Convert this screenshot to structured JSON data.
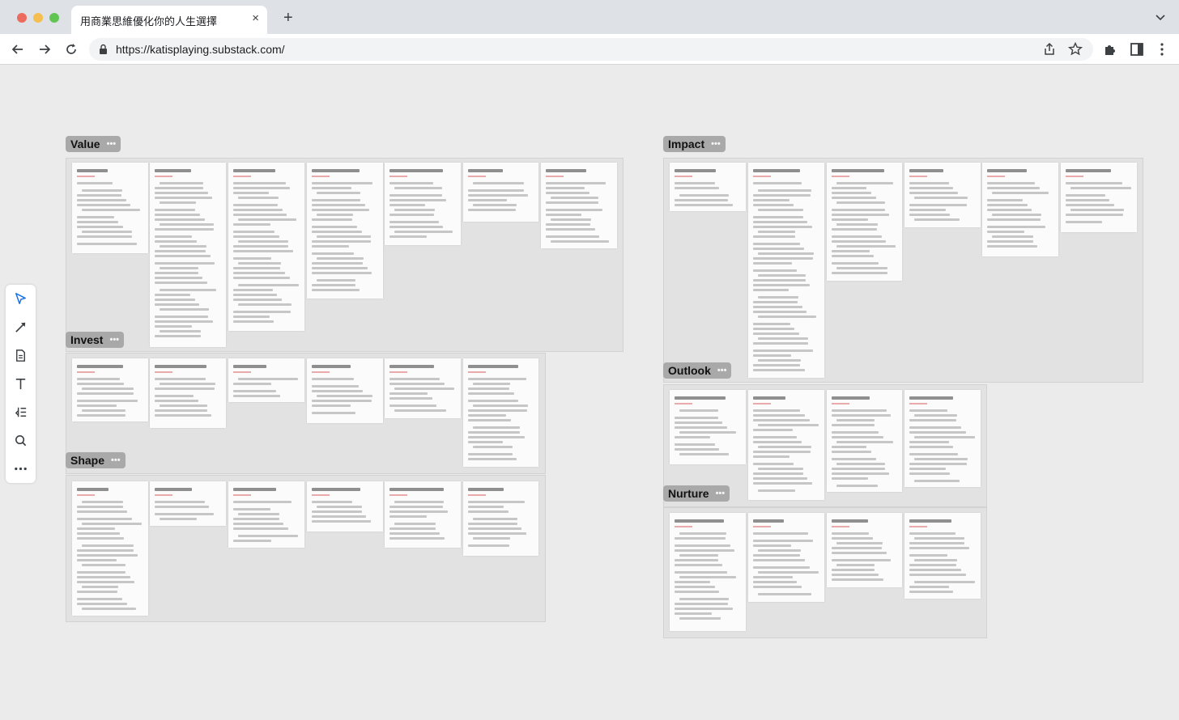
{
  "browser": {
    "tab_title": "用商業思維優化你的人生選擇",
    "tab_close": "×",
    "new_tab": "+",
    "url": "https://katisplaying.substack.com/"
  },
  "canvas": {
    "groups": [
      {
        "label": "Value",
        "dots": "•••"
      },
      {
        "label": "Invest",
        "dots": "•••"
      },
      {
        "label": "Shape",
        "dots": "•••"
      },
      {
        "label": "Impact",
        "dots": "•••"
      },
      {
        "label": "Outlook",
        "dots": "•••"
      },
      {
        "label": "Nurture",
        "dots": "•••"
      }
    ]
  },
  "tools": [
    "select-arrow-icon",
    "connector-icon",
    "note-icon",
    "text-icon",
    "outline-icon",
    "search-icon",
    "more-icon"
  ],
  "colors": {
    "canvas_bg": "#ebebeb",
    "group_bg": "#e2e2e2",
    "label_bg": "#a9a9a9",
    "active_tool": "#1a73e8"
  }
}
